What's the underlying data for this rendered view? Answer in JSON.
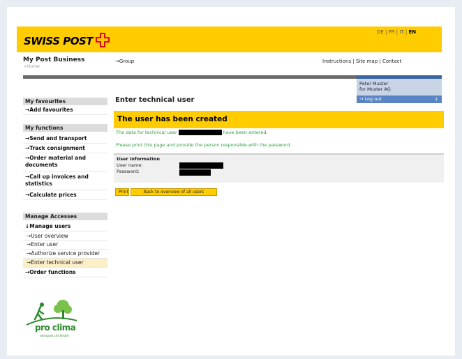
{
  "header": {
    "logo": "SWISS POST",
    "languages": [
      "DE",
      "FR",
      "IT",
      "EN"
    ],
    "active_language": "EN",
    "app_title": "My Post Business",
    "breadcrumb": ">Home",
    "group_link": "→Group",
    "utility_links": [
      "Instructions",
      "Site map",
      "Contact"
    ]
  },
  "user": {
    "name": "Peter Muster",
    "company": "for Muster AG",
    "logout": "→ Log out",
    "logout_arrow": "↓"
  },
  "sidebar": {
    "favourites_head": "My favourites",
    "add_favourites": "→Add favourites",
    "functions_head": "My functions",
    "functions": [
      "→Send and transport",
      "→Track consignment",
      "→Order material and documents",
      "→Call up invoices and statistics",
      "→Calculate prices"
    ],
    "manage_head": "Manage Accesses",
    "manage_users": "↓Manage users",
    "manage_sub": [
      "→User overview",
      "→Enter user",
      "→Authorize service provider",
      "→Enter technical user"
    ],
    "active_sub": 3,
    "order_functions": "→Order functions"
  },
  "main": {
    "title": "Enter technical user",
    "success": "The user has been created",
    "message_prefix": "The data for technical user",
    "message_suffix": "have been entered.",
    "print_notice": "Please print this page and provide the person responsible with the password.",
    "info_header": "User information",
    "username_label": "User name:",
    "password_label": "Password:",
    "print_button": "Print",
    "back_button": "Back to overview of all users"
  },
  "proclima": {
    "brand": "pro clima",
    "tagline": "swisspost.ch/climate"
  },
  "colors": {
    "brand_yellow": "#ffcc00",
    "success_green": "#2ea043",
    "logout_blue": "#5b84c4"
  }
}
